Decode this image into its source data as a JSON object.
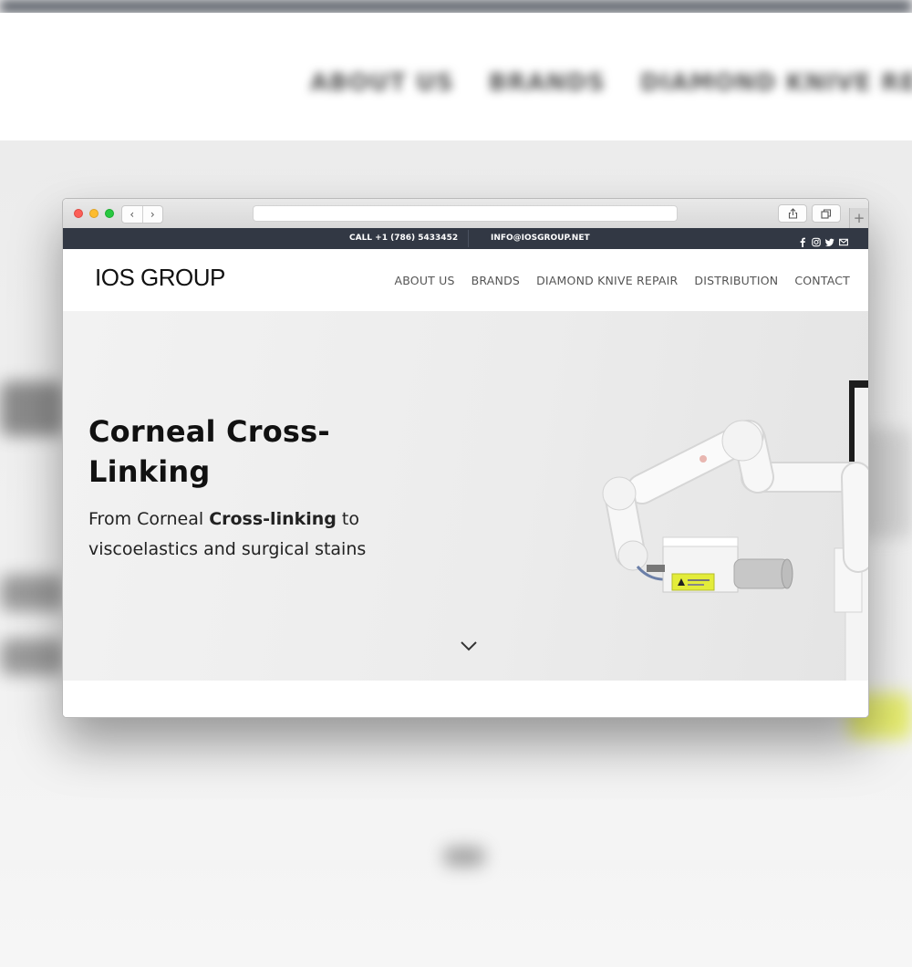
{
  "background": {
    "nav_items": [
      "ABOUT US",
      "BRANDS",
      "DIAMOND KNIVE REPAIR"
    ]
  },
  "browser": {
    "back_symbol": "‹",
    "forward_symbol": "›",
    "new_tab_symbol": "+"
  },
  "site": {
    "topbar": {
      "phone": "CALL +1 (786) 5433452",
      "email": "INFO@IOSGROUP.NET",
      "social_icons": [
        "facebook-icon",
        "instagram-icon",
        "twitter-icon",
        "mail-icon"
      ]
    },
    "logo": "IOS GROUP",
    "nav": [
      "ABOUT US",
      "BRANDS",
      "DIAMOND KNIVE REPAIR",
      "DISTRIBUTION",
      "CONTACT"
    ],
    "hero": {
      "title": "Corneal Cross-Linking",
      "subtitle_start": "From Corneal ",
      "subtitle_bold": "Cross-linking",
      "subtitle_end": " to viscoelastics and surgical stains"
    }
  },
  "colors": {
    "topbar_bg": "#323844",
    "text_dark": "#111111",
    "nav_text": "#555555",
    "hero_bg": "#ececec",
    "device_label": "#e3ec3a"
  }
}
